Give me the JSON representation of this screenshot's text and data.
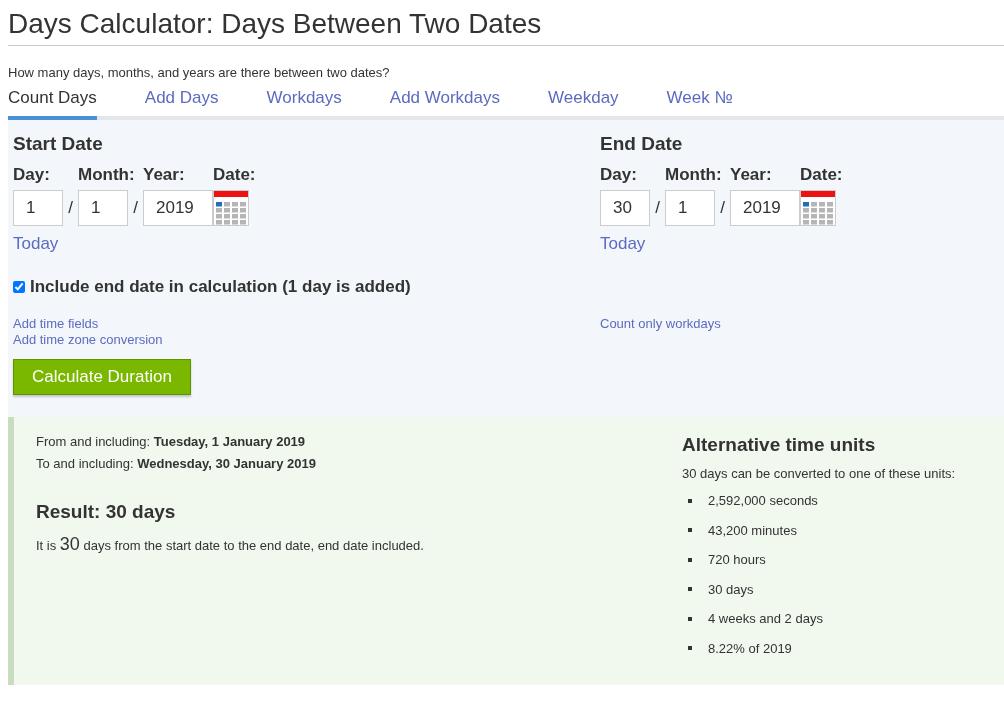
{
  "title": "Days Calculator: Days Between Two Dates",
  "subtitle": "How many days, months, and years are there between two dates?",
  "tabs": [
    {
      "label": "Count Days",
      "selected": true
    },
    {
      "label": "Add Days",
      "selected": false
    },
    {
      "label": "Workdays",
      "selected": false
    },
    {
      "label": "Add Workdays",
      "selected": false
    },
    {
      "label": "Weekday",
      "selected": false
    },
    {
      "label": "Week №",
      "selected": false
    }
  ],
  "dates": [
    {
      "heading": "Start Date",
      "day_label": "Day:",
      "month_label": "Month:",
      "year_label": "Year:",
      "date_label": "Date:",
      "day": "1",
      "month": "1",
      "year": "2019",
      "separator": "/",
      "today": "Today",
      "links": [
        "Add time fields",
        "Add time zone conversion"
      ]
    },
    {
      "heading": "End Date",
      "day_label": "Day:",
      "month_label": "Month:",
      "year_label": "Year:",
      "date_label": "Date:",
      "day": "30",
      "month": "1",
      "year": "2019",
      "separator": "/",
      "today": "Today",
      "links": [
        "Count only workdays"
      ]
    }
  ],
  "include_end": {
    "label": "Include end date in calculation (1 day is added)",
    "checked": true
  },
  "calculate_button": "Calculate Duration",
  "result": {
    "from_label": "From and including:",
    "from_value": "Tuesday, 1 January 2019",
    "to_label": "To and including:",
    "to_value": "Wednesday, 30 January 2019",
    "heading": "Result: 30 days",
    "sentence_start": "It is",
    "number": "30",
    "sentence_end": "days from the start date to the end date, end date included."
  },
  "alternative": {
    "heading": "Alternative time units",
    "intro": "30 days can be converted to one of these units:",
    "units": [
      "2,592,000 seconds",
      "43,200 minutes",
      "720 hours",
      "30 days",
      "4 weeks and 2 days",
      "8.22% of 2019"
    ]
  }
}
